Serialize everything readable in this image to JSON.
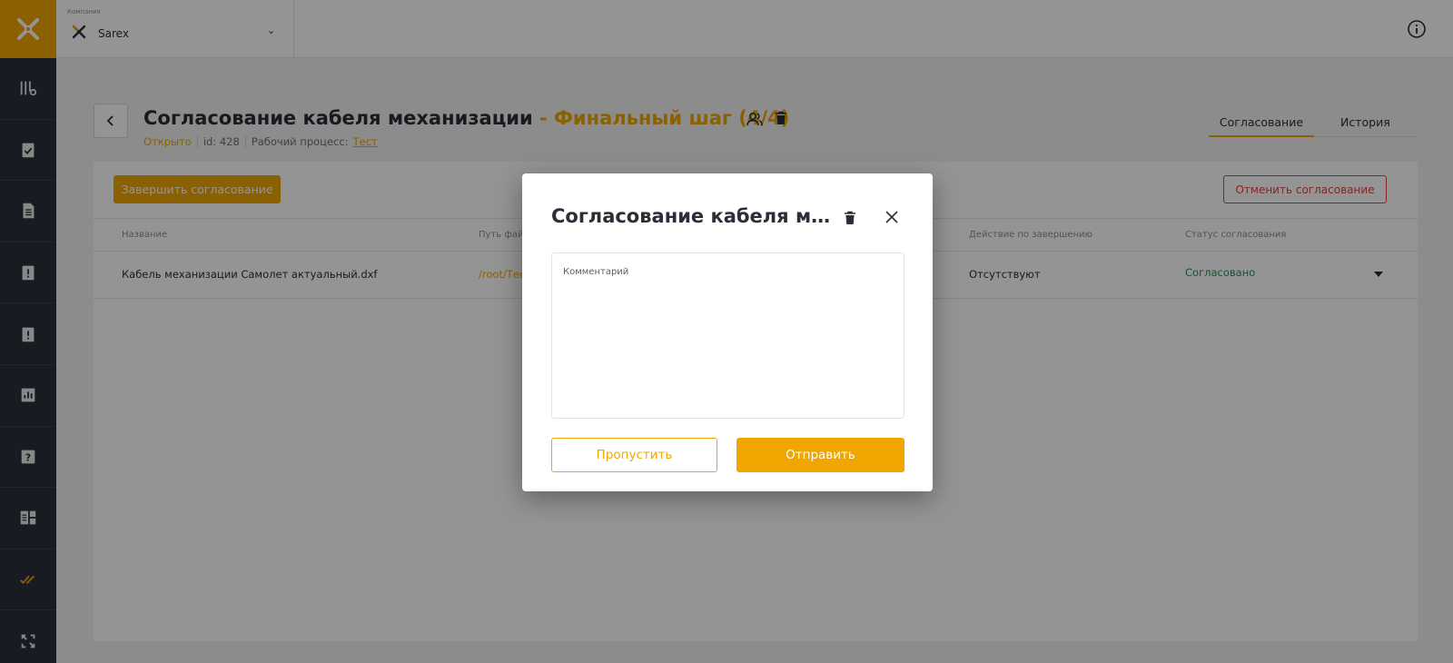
{
  "topbar": {
    "company_label": "Компания",
    "company_name": "Sarex",
    "info_icon": "info-icon"
  },
  "sidebar": {
    "items": [
      {
        "icon": "route-icon"
      },
      {
        "icon": "clipboard-check-icon"
      },
      {
        "icon": "document-icon"
      },
      {
        "icon": "clipboard-alert-icon"
      },
      {
        "icon": "clipboard-alert-icon"
      },
      {
        "icon": "chart-icon"
      },
      {
        "icon": "help-icon"
      },
      {
        "icon": "layout-icon"
      },
      {
        "icon": "double-check-icon"
      },
      {
        "icon": "sync-icon"
      }
    ]
  },
  "header": {
    "title": "Согласование кабеля механизации",
    "step": " - Финальный шаг (4/4)",
    "status": "Открыто",
    "id_text": "id: 428",
    "workflow_label": "Рабочий процесс:",
    "workflow_link": "Тест"
  },
  "tabs": {
    "active": "Согласование",
    "history": "История"
  },
  "panel": {
    "finish_button": "Завершить согласование",
    "cancel_button": "Отменить согласование",
    "columns": [
      "Название",
      "Путь файла",
      "Действие по завершению",
      "Статус согласования"
    ],
    "rows": [
      {
        "name": "Кабель механизации Самолет актуальный.dxf",
        "path": "/root/Тест",
        "action": "Отсутствуют",
        "status": "Согласовано"
      }
    ]
  },
  "modal": {
    "title": "Согласование кабеля механизации",
    "comment_label": "Комментарий",
    "comment_value": "",
    "skip_button": "Пропустить",
    "send_button": "Отправить"
  },
  "colors": {
    "accent": "#f0a500",
    "sidebar": "#2a2f3a",
    "danger": "#e0443f",
    "success": "#2e8b57"
  }
}
